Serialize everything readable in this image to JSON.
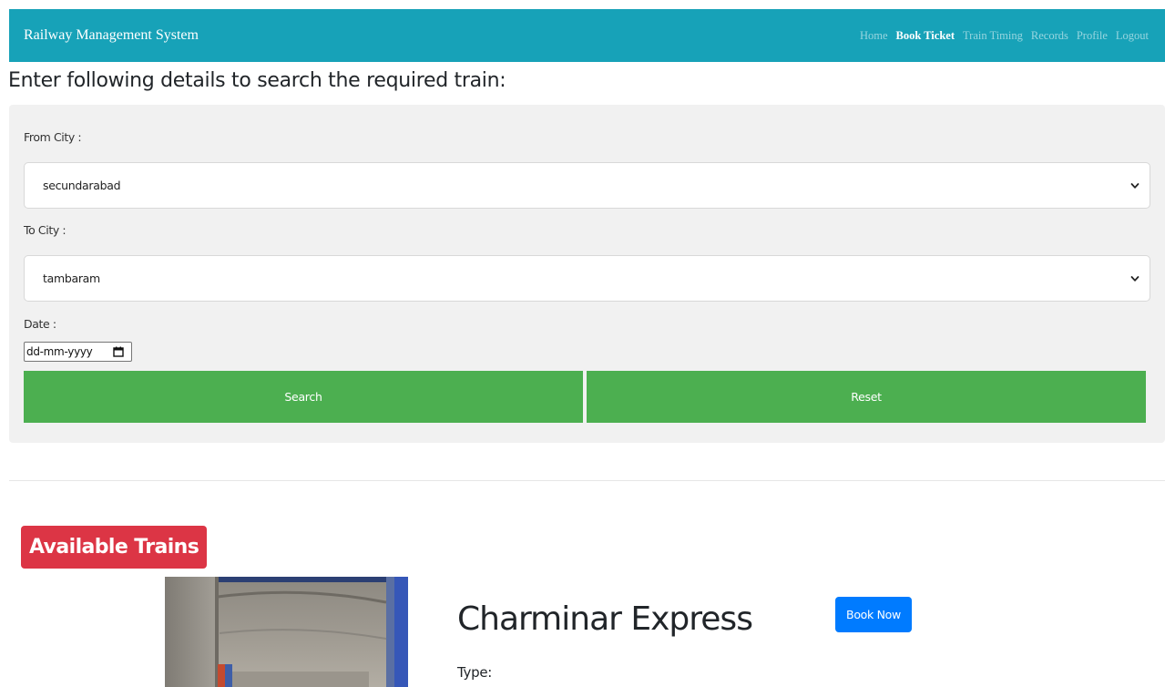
{
  "nav": {
    "brand": "Railway Management System",
    "links": [
      "Home",
      "Book Ticket",
      "Train Timing",
      "Records",
      "Profile",
      "Logout"
    ],
    "active": "Book Ticket"
  },
  "search": {
    "heading": "Enter following details to search the required train:",
    "from_label": "From City :",
    "from_value": "secundarabad",
    "to_label": "To City :",
    "to_value": "tambaram",
    "date_label": "Date :",
    "date_placeholder": "dd-mm-yyyy",
    "search_button": "Search",
    "reset_button": "Reset"
  },
  "results": {
    "heading": "Available Trains",
    "trains": [
      {
        "name": "Charminar Express",
        "book_button": "Book Now",
        "type_label": "Type:"
      }
    ]
  },
  "colors": {
    "navbar": "#17a2b8",
    "panel": "#f1f1f1",
    "success": "#4caf50",
    "danger": "#dc3545",
    "primary": "#007bff"
  },
  "icons": {
    "dropdown": "chevron-down-icon",
    "date": "calendar-icon"
  }
}
